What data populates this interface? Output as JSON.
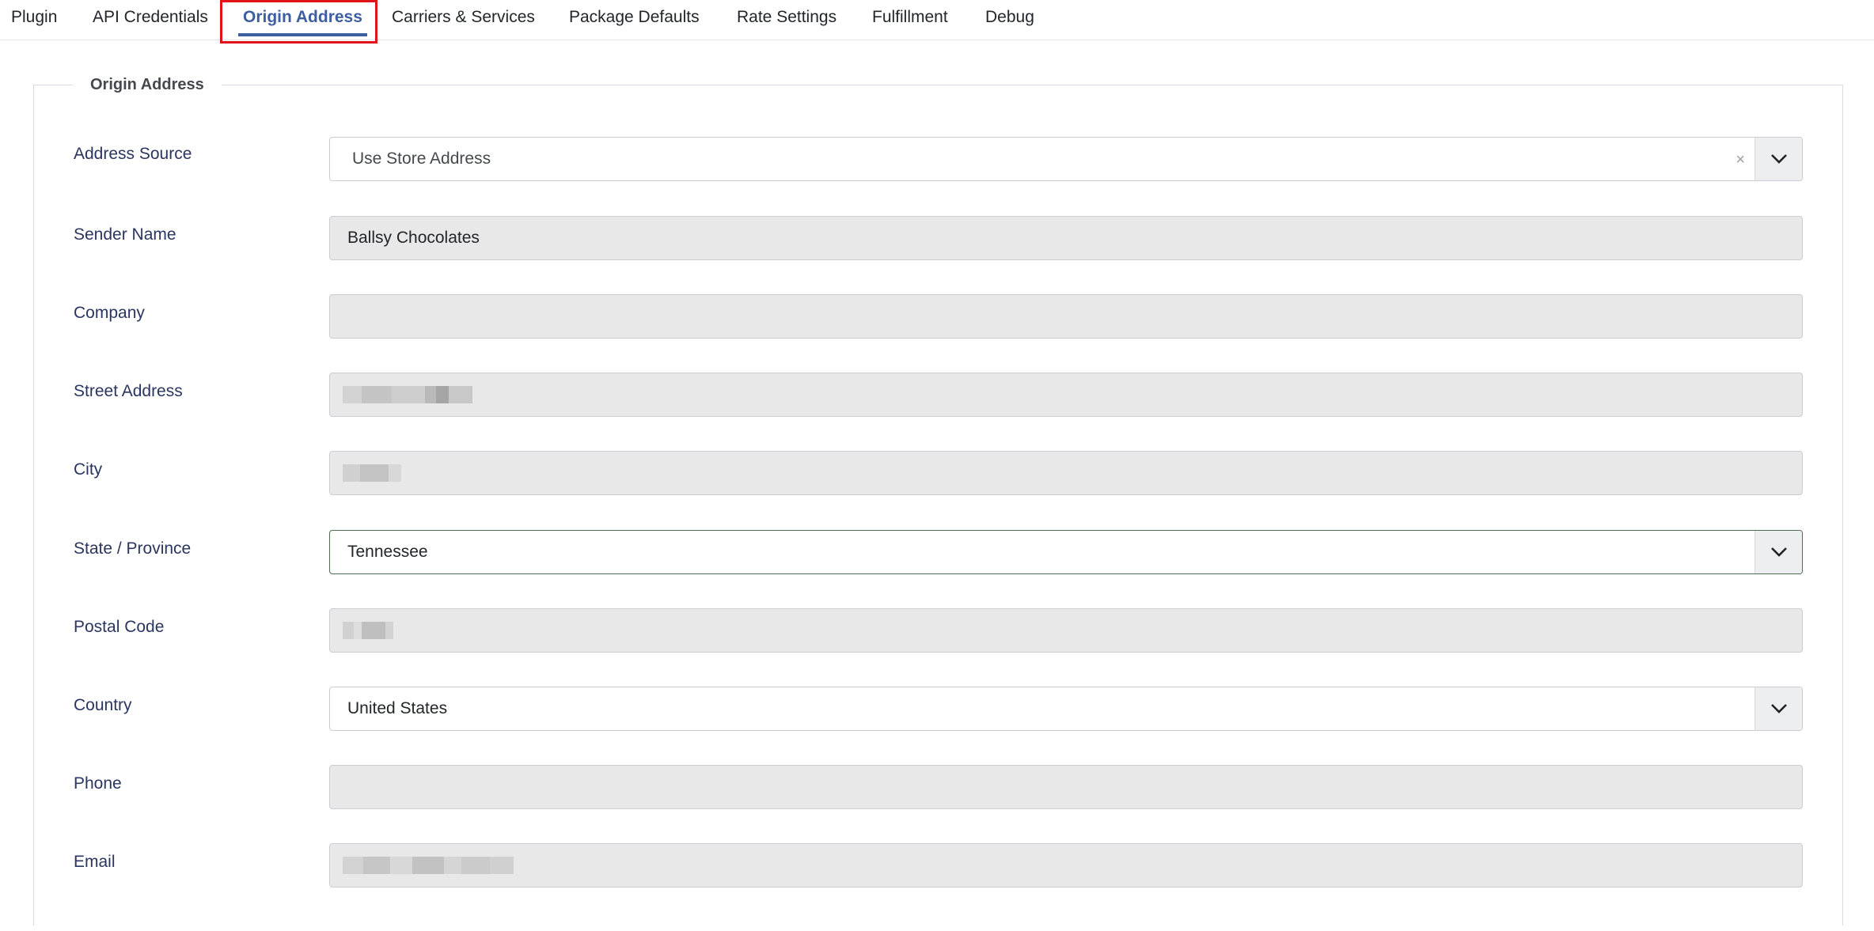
{
  "tabs": [
    {
      "label": "Plugin",
      "active": false
    },
    {
      "label": "API Credentials",
      "active": false
    },
    {
      "label": "Origin Address",
      "active": true
    },
    {
      "label": "Carriers & Services",
      "active": false
    },
    {
      "label": "Package Defaults",
      "active": false
    },
    {
      "label": "Rate Settings",
      "active": false
    },
    {
      "label": "Fulfillment",
      "active": false
    },
    {
      "label": "Debug",
      "active": false
    }
  ],
  "section": {
    "legend": "Origin Address"
  },
  "fields": {
    "address_source": {
      "label": "Address Source",
      "value": "Use Store Address",
      "clear": "×"
    },
    "sender_name": {
      "label": "Sender Name",
      "value": "Ballsy Chocolates"
    },
    "company": {
      "label": "Company",
      "value": ""
    },
    "street_address": {
      "label": "Street Address",
      "value": ""
    },
    "city": {
      "label": "City",
      "value": ""
    },
    "state": {
      "label": "State / Province",
      "value": "Tennessee"
    },
    "postal_code": {
      "label": "Postal Code",
      "value": ""
    },
    "country": {
      "label": "Country",
      "value": "United States"
    },
    "phone": {
      "label": "Phone",
      "value": ""
    },
    "email": {
      "label": "Email",
      "value": ""
    }
  },
  "colors": {
    "accent": "#3d5fa2",
    "focus_outline": "#e0121a",
    "label_text": "#2a3560",
    "readonly_bg": "#e8e8e8"
  }
}
